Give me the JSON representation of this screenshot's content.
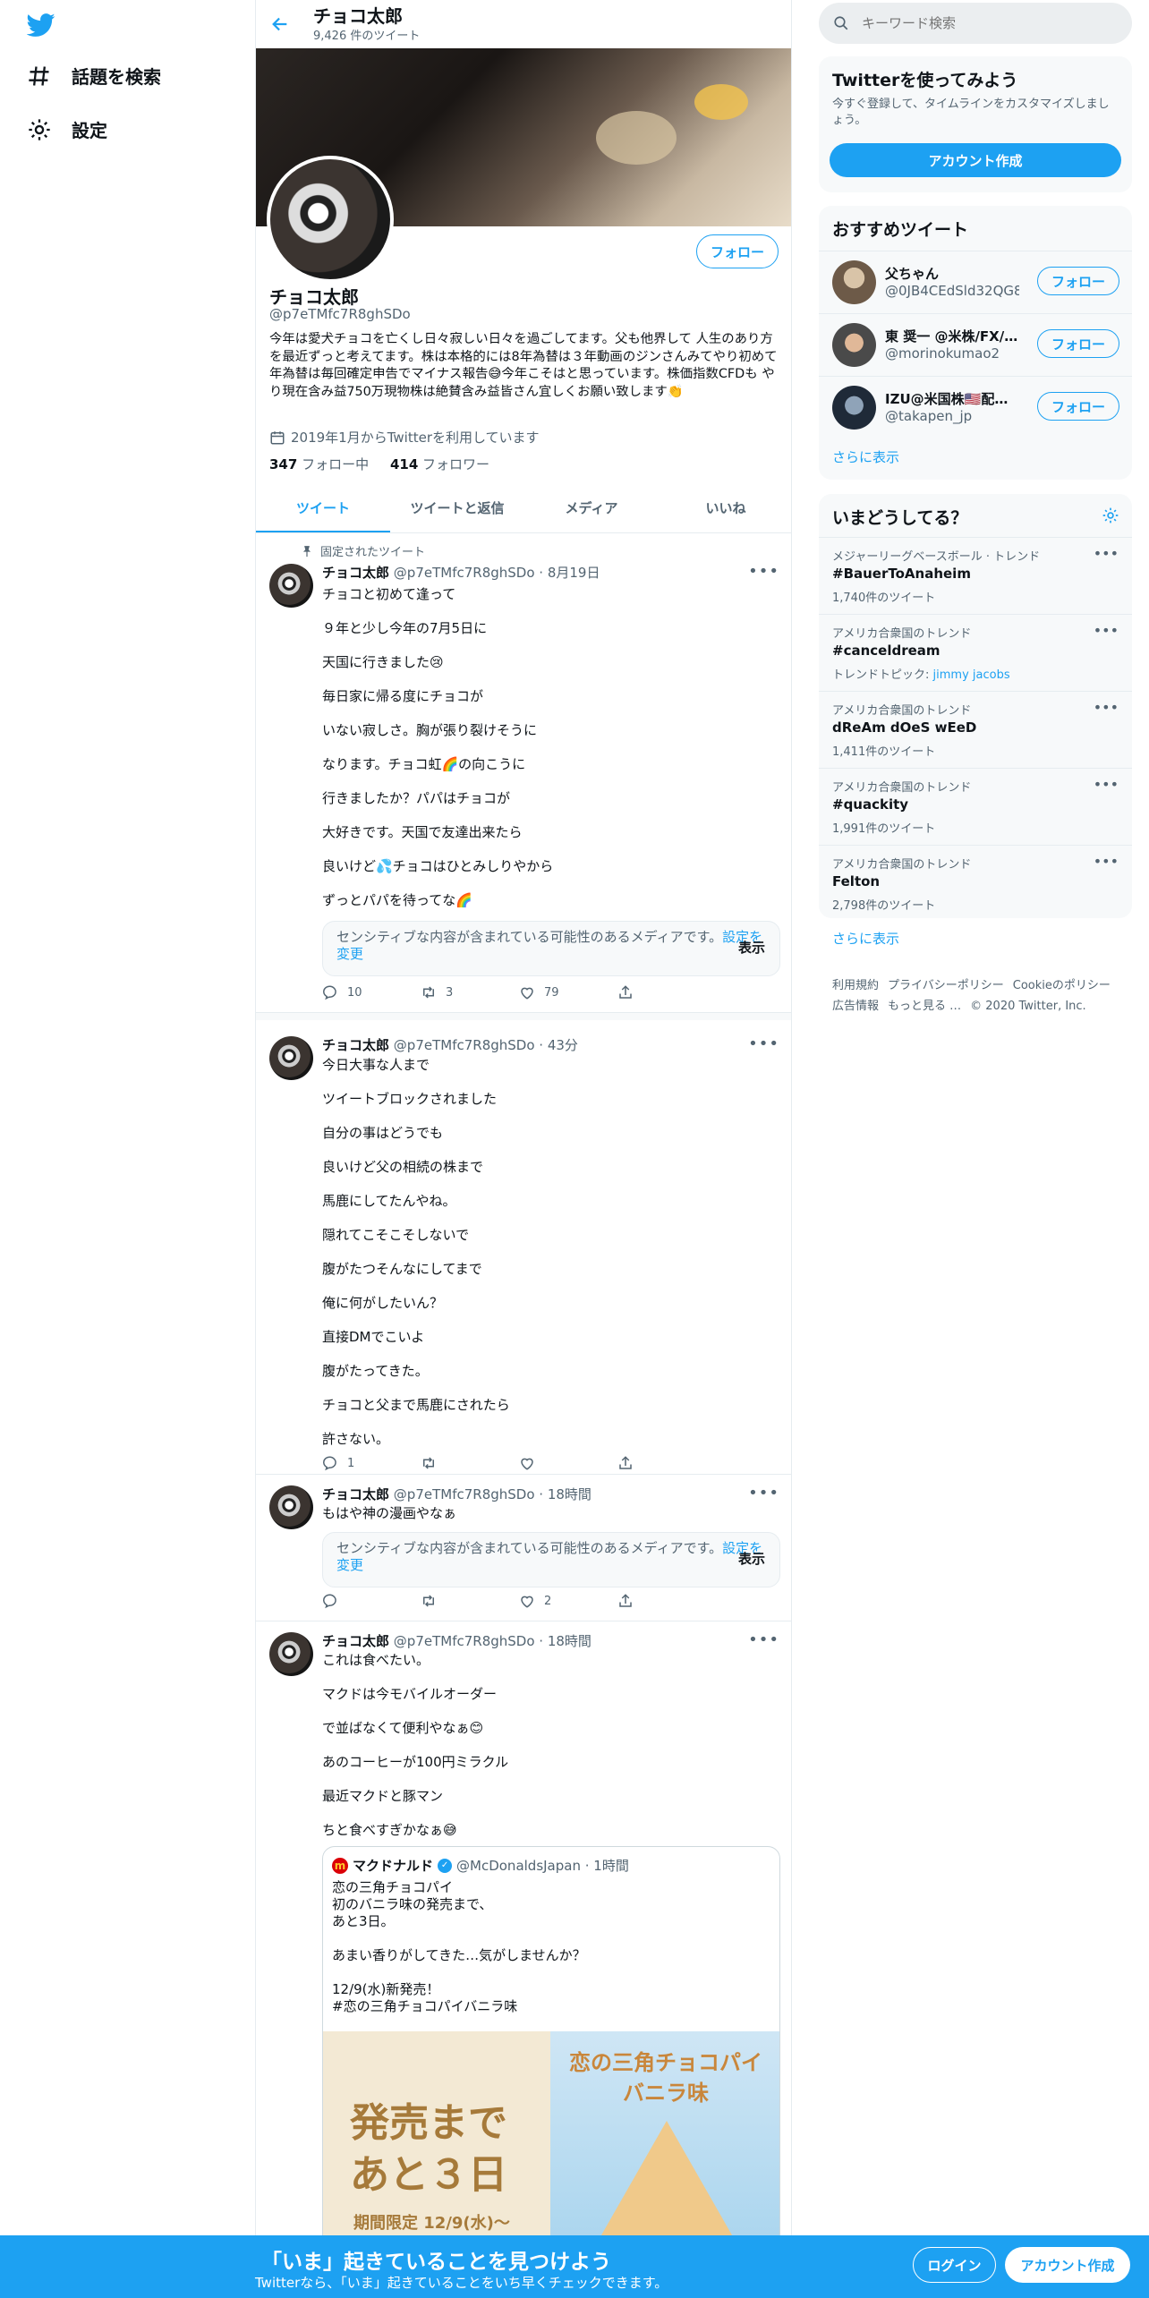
{
  "nav": {
    "explore_label": "話題を検索",
    "settings_label": "設定"
  },
  "header": {
    "name": "チョコ太郎",
    "tweet_count": "9,426 件のツイート"
  },
  "profile": {
    "name": "チョコ太郎",
    "handle": "@p7eTMfc7R8ghSDo",
    "follow_label": "フォロー",
    "bio": "今年は愛犬チョコを亡くし日々寂しい日々を過ごしてます。父も他界して 人生のあり方を最近ずっと考えてます。株は本格的には8年為替は３年動画のジンさんみてやり初めて年為替は毎回確定申告でマイナス報告😅今年こそはと思っています。株価指数CFDも やり現在含み益750万現物株は絶賛含み益皆さん宜しくお願い致します👏",
    "joined": "2019年1月からTwitterを利用しています",
    "following_count": "347",
    "following_label": "フォロー中",
    "followers_count": "414",
    "followers_label": "フォロワー"
  },
  "tabs": [
    "ツイート",
    "ツイートと返信",
    "メディア",
    "いいね"
  ],
  "pinned_label": "固定されたツイート",
  "sensitive": {
    "text": "センシティブな内容が含まれている可能性のあるメディアです。",
    "link": "設定を変更",
    "show": "表示"
  },
  "tweets": [
    {
      "name": "チョコ太郎",
      "meta": "@p7eTMfc7R8ghSDo · 8月19日",
      "lines": [
        "チョコと初めて逢って",
        "９年と少し今年の7月5日に",
        "天国に行きました😢",
        "毎日家に帰る度にチョコが",
        "いない寂しさ。胸が張り裂けそうに",
        "なります。チョコ虹🌈の向こうに",
        "行きましたか？パパはチョコが",
        "大好きです。天国で友達出来たら",
        "良いけど💦チョコはひとみしりやから",
        "ずっとパパを待ってな🌈"
      ],
      "replies": "10",
      "retweets": "3",
      "likes": "79"
    },
    {
      "name": "チョコ太郎",
      "meta": "@p7eTMfc7R8ghSDo · 43分",
      "lines": [
        "今日大事な人まで",
        "ツイートブロックされました",
        "自分の事はどうでも",
        "良いけど父の相続の株まで",
        "馬鹿にしてたんやね。",
        "隠れてこそこそしないで",
        "腹がたつそんなにしてまで",
        "俺に何がしたいん？",
        "直接DMでこいよ",
        "腹がたってきた。",
        "チョコと父まで馬鹿にされたら",
        "許さない。"
      ],
      "replies": "1",
      "retweets": "",
      "likes": ""
    },
    {
      "name": "チョコ太郎",
      "meta": "@p7eTMfc7R8ghSDo · 18時間",
      "lines": [
        "もはや神の漫画やなぁ"
      ],
      "replies": "",
      "retweets": "",
      "likes": "2"
    },
    {
      "name": "チョコ太郎",
      "meta": "@p7eTMfc7R8ghSDo · 18時間",
      "lines": [
        "これは食べたい。",
        "マクドは今モバイルオーダー",
        "で並ばなくて便利やなぁ😊",
        "あのコーヒーが100円ミラクル",
        "最近マクドと豚マン",
        "ちと食べすぎかなぁ😅"
      ]
    }
  ],
  "quote": {
    "name": "マクドナルド",
    "meta": "@McDonaldsJapan · 1時間",
    "text": "恋の三角チョコパイ\n初のバニラ味の発売まで、\nあと3日。\n\nあまい香りがしてきた…気がしませんか？\n\n12/9(水)新発売！\n#恋の三角チョコパイバニラ味",
    "img_left_big": "発売まで\nあと３日",
    "img_left_small": "期間限定 12/9(水)〜",
    "img_right_title": "恋の三角チョコパイ\nバニラ味"
  },
  "search": {
    "placeholder": "キーワード検索"
  },
  "signup_box": {
    "title": "Twitterを使ってみよう",
    "sub": "今すぐ登録して、タイムラインをカスタマイズしましょう。",
    "button": "アカウント作成"
  },
  "recommended": {
    "title": "おすすめツイート",
    "users": [
      {
        "name": "父ちゃん",
        "handle": "@0JB4CEdSld32QG8"
      },
      {
        "name": "東 奨一 @米株/FX/不…",
        "handle": "@morinokumao2"
      },
      {
        "name": "IZU@米国株🇺🇸配当…",
        "handle": "@takapen_jp"
      }
    ],
    "follow": "フォロー",
    "more": "さらに表示"
  },
  "trends": {
    "title": "いまどうしてる？",
    "items": [
      {
        "context": "メジャーリーグベースボール · トレンド",
        "name": "#BauerToAnaheim",
        "count": "1,740件のツイート",
        "topic_label": "",
        "topic": ""
      },
      {
        "context": "アメリカ合衆国のトレンド",
        "name": "#canceldream",
        "count": "",
        "topic_label": "トレンドトピック: ",
        "topic": "jimmy jacobs"
      },
      {
        "context": "アメリカ合衆国のトレンド",
        "name": "dReAm dOeS wEeD",
        "count": "1,411件のツイート",
        "topic_label": "",
        "topic": ""
      },
      {
        "context": "アメリカ合衆国のトレンド",
        "name": "#quackity",
        "count": "1,991件のツイート",
        "topic_label": "",
        "topic": ""
      },
      {
        "context": "アメリカ合衆国のトレンド",
        "name": "Felton",
        "count": "2,798件のツイート",
        "topic_label": "",
        "topic": ""
      }
    ],
    "more": "さらに表示"
  },
  "footer": {
    "links": [
      "利用規約",
      "プライバシーポリシー",
      "Cookieのポリシー",
      "広告情報",
      "もっと見る …"
    ],
    "copyright": "© 2020 Twitter, Inc."
  },
  "bottom_bar": {
    "title": "「いま」起きていることを見つけよう",
    "sub": "Twitterなら、「いま」起きていることをいち早くチェックできます。",
    "login": "ログイン",
    "signup": "アカウント作成"
  },
  "colors": {
    "accent": "#1da1f2",
    "muted": "#536471",
    "border": "#e6ecf0"
  }
}
